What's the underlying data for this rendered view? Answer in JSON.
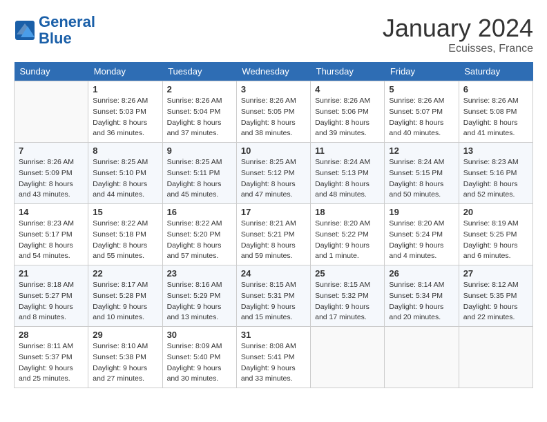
{
  "header": {
    "logo_line1": "General",
    "logo_line2": "Blue",
    "month_year": "January 2024",
    "location": "Ecuisses, France"
  },
  "weekdays": [
    "Sunday",
    "Monday",
    "Tuesday",
    "Wednesday",
    "Thursday",
    "Friday",
    "Saturday"
  ],
  "weeks": [
    [
      {
        "day": "",
        "info": ""
      },
      {
        "day": "1",
        "info": "Sunrise: 8:26 AM\nSunset: 5:03 PM\nDaylight: 8 hours\nand 36 minutes."
      },
      {
        "day": "2",
        "info": "Sunrise: 8:26 AM\nSunset: 5:04 PM\nDaylight: 8 hours\nand 37 minutes."
      },
      {
        "day": "3",
        "info": "Sunrise: 8:26 AM\nSunset: 5:05 PM\nDaylight: 8 hours\nand 38 minutes."
      },
      {
        "day": "4",
        "info": "Sunrise: 8:26 AM\nSunset: 5:06 PM\nDaylight: 8 hours\nand 39 minutes."
      },
      {
        "day": "5",
        "info": "Sunrise: 8:26 AM\nSunset: 5:07 PM\nDaylight: 8 hours\nand 40 minutes."
      },
      {
        "day": "6",
        "info": "Sunrise: 8:26 AM\nSunset: 5:08 PM\nDaylight: 8 hours\nand 41 minutes."
      }
    ],
    [
      {
        "day": "7",
        "info": "Sunrise: 8:26 AM\nSunset: 5:09 PM\nDaylight: 8 hours\nand 43 minutes."
      },
      {
        "day": "8",
        "info": "Sunrise: 8:25 AM\nSunset: 5:10 PM\nDaylight: 8 hours\nand 44 minutes."
      },
      {
        "day": "9",
        "info": "Sunrise: 8:25 AM\nSunset: 5:11 PM\nDaylight: 8 hours\nand 45 minutes."
      },
      {
        "day": "10",
        "info": "Sunrise: 8:25 AM\nSunset: 5:12 PM\nDaylight: 8 hours\nand 47 minutes."
      },
      {
        "day": "11",
        "info": "Sunrise: 8:24 AM\nSunset: 5:13 PM\nDaylight: 8 hours\nand 48 minutes."
      },
      {
        "day": "12",
        "info": "Sunrise: 8:24 AM\nSunset: 5:15 PM\nDaylight: 8 hours\nand 50 minutes."
      },
      {
        "day": "13",
        "info": "Sunrise: 8:23 AM\nSunset: 5:16 PM\nDaylight: 8 hours\nand 52 minutes."
      }
    ],
    [
      {
        "day": "14",
        "info": "Sunrise: 8:23 AM\nSunset: 5:17 PM\nDaylight: 8 hours\nand 54 minutes."
      },
      {
        "day": "15",
        "info": "Sunrise: 8:22 AM\nSunset: 5:18 PM\nDaylight: 8 hours\nand 55 minutes."
      },
      {
        "day": "16",
        "info": "Sunrise: 8:22 AM\nSunset: 5:20 PM\nDaylight: 8 hours\nand 57 minutes."
      },
      {
        "day": "17",
        "info": "Sunrise: 8:21 AM\nSunset: 5:21 PM\nDaylight: 8 hours\nand 59 minutes."
      },
      {
        "day": "18",
        "info": "Sunrise: 8:20 AM\nSunset: 5:22 PM\nDaylight: 9 hours\nand 1 minute."
      },
      {
        "day": "19",
        "info": "Sunrise: 8:20 AM\nSunset: 5:24 PM\nDaylight: 9 hours\nand 4 minutes."
      },
      {
        "day": "20",
        "info": "Sunrise: 8:19 AM\nSunset: 5:25 PM\nDaylight: 9 hours\nand 6 minutes."
      }
    ],
    [
      {
        "day": "21",
        "info": "Sunrise: 8:18 AM\nSunset: 5:27 PM\nDaylight: 9 hours\nand 8 minutes."
      },
      {
        "day": "22",
        "info": "Sunrise: 8:17 AM\nSunset: 5:28 PM\nDaylight: 9 hours\nand 10 minutes."
      },
      {
        "day": "23",
        "info": "Sunrise: 8:16 AM\nSunset: 5:29 PM\nDaylight: 9 hours\nand 13 minutes."
      },
      {
        "day": "24",
        "info": "Sunrise: 8:15 AM\nSunset: 5:31 PM\nDaylight: 9 hours\nand 15 minutes."
      },
      {
        "day": "25",
        "info": "Sunrise: 8:15 AM\nSunset: 5:32 PM\nDaylight: 9 hours\nand 17 minutes."
      },
      {
        "day": "26",
        "info": "Sunrise: 8:14 AM\nSunset: 5:34 PM\nDaylight: 9 hours\nand 20 minutes."
      },
      {
        "day": "27",
        "info": "Sunrise: 8:12 AM\nSunset: 5:35 PM\nDaylight: 9 hours\nand 22 minutes."
      }
    ],
    [
      {
        "day": "28",
        "info": "Sunrise: 8:11 AM\nSunset: 5:37 PM\nDaylight: 9 hours\nand 25 minutes."
      },
      {
        "day": "29",
        "info": "Sunrise: 8:10 AM\nSunset: 5:38 PM\nDaylight: 9 hours\nand 27 minutes."
      },
      {
        "day": "30",
        "info": "Sunrise: 8:09 AM\nSunset: 5:40 PM\nDaylight: 9 hours\nand 30 minutes."
      },
      {
        "day": "31",
        "info": "Sunrise: 8:08 AM\nSunset: 5:41 PM\nDaylight: 9 hours\nand 33 minutes."
      },
      {
        "day": "",
        "info": ""
      },
      {
        "day": "",
        "info": ""
      },
      {
        "day": "",
        "info": ""
      }
    ]
  ]
}
